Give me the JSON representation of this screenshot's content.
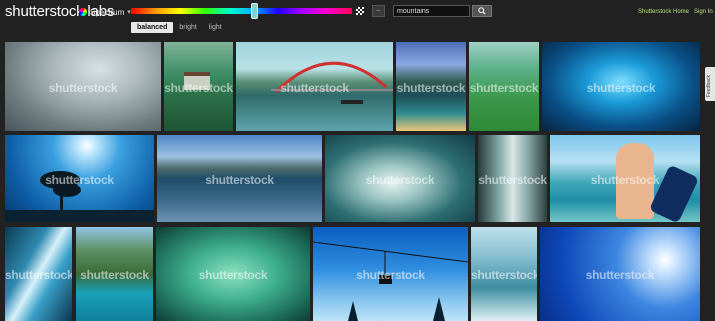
{
  "header": {
    "logo_main": "shutterstock",
    "logo_suffix": " labs",
    "spectrum_label": "Spectrum",
    "search_value": "mountains",
    "search_button_icon": "search-icon",
    "home_link": "Shutterstock Home",
    "signin_link": "Sign In",
    "option_button_icon": "adjust-icon"
  },
  "tabs": [
    {
      "label": "balanced",
      "active": true
    },
    {
      "label": "bright",
      "active": false
    },
    {
      "label": "light",
      "active": false
    }
  ],
  "feedback_label": "Feedback",
  "watermark": "shutterstock",
  "images": [
    {
      "subject": "misty-gray-forest"
    },
    {
      "subject": "green-hill-pagoda"
    },
    {
      "subject": "river-arch-bridge"
    },
    {
      "subject": "mountain-lake-sunset"
    },
    {
      "subject": "green-hills-meadow"
    },
    {
      "subject": "underwater-blue-light"
    },
    {
      "subject": "lone-tree-blue-sky"
    },
    {
      "subject": "lake-birds-mountains"
    },
    {
      "subject": "white-blossoms-teal"
    },
    {
      "subject": "waterfall-rocks"
    },
    {
      "subject": "snorkel-couple-beach"
    },
    {
      "subject": "waterfall-cliff-blue"
    },
    {
      "subject": "karst-islands-sea"
    },
    {
      "subject": "green-moss-rock"
    },
    {
      "subject": "cable-car-blue-sky"
    },
    {
      "subject": "snow-forest-stream"
    },
    {
      "subject": "blue-sky-sun"
    }
  ]
}
